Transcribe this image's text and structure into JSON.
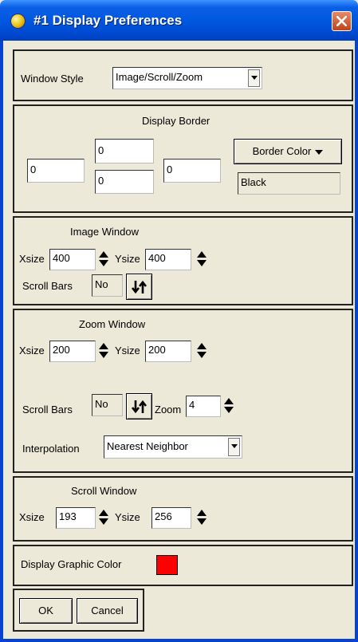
{
  "window": {
    "title": "#1 Display Preferences",
    "title_icon": "app-globe-icon",
    "close_icon": "close-icon",
    "close_color": "#d14a20"
  },
  "window_style": {
    "label": "Window Style",
    "value": "Image/Scroll/Zoom"
  },
  "display_border": {
    "heading": "Display Border",
    "left": "0",
    "top": "0",
    "bottom": "0",
    "right": "0",
    "color_button": "Border Color",
    "color_value": "Black"
  },
  "image_window": {
    "heading": "Image Window",
    "xsize_label": "Xsize",
    "xsize": "400",
    "ysize_label": "Ysize",
    "ysize": "400",
    "scrollbars_label": "Scroll Bars",
    "scrollbars": "No"
  },
  "zoom_window": {
    "heading": "Zoom Window",
    "xsize_label": "Xsize",
    "xsize": "200",
    "ysize_label": "Ysize",
    "ysize": "200",
    "scrollbars_label": "Scroll Bars",
    "scrollbars": "No",
    "zoom_label": "Zoom",
    "zoom": "4",
    "interp_label": "Interpolation",
    "interp": "Nearest Neighbor"
  },
  "scroll_window": {
    "heading": "Scroll Window",
    "xsize_label": "Xsize",
    "xsize": "193",
    "ysize_label": "Ysize",
    "ysize": "256"
  },
  "graphic": {
    "label": "Display Graphic Color",
    "color": "#ff0000"
  },
  "buttons": {
    "ok": "OK",
    "cancel": "Cancel"
  }
}
